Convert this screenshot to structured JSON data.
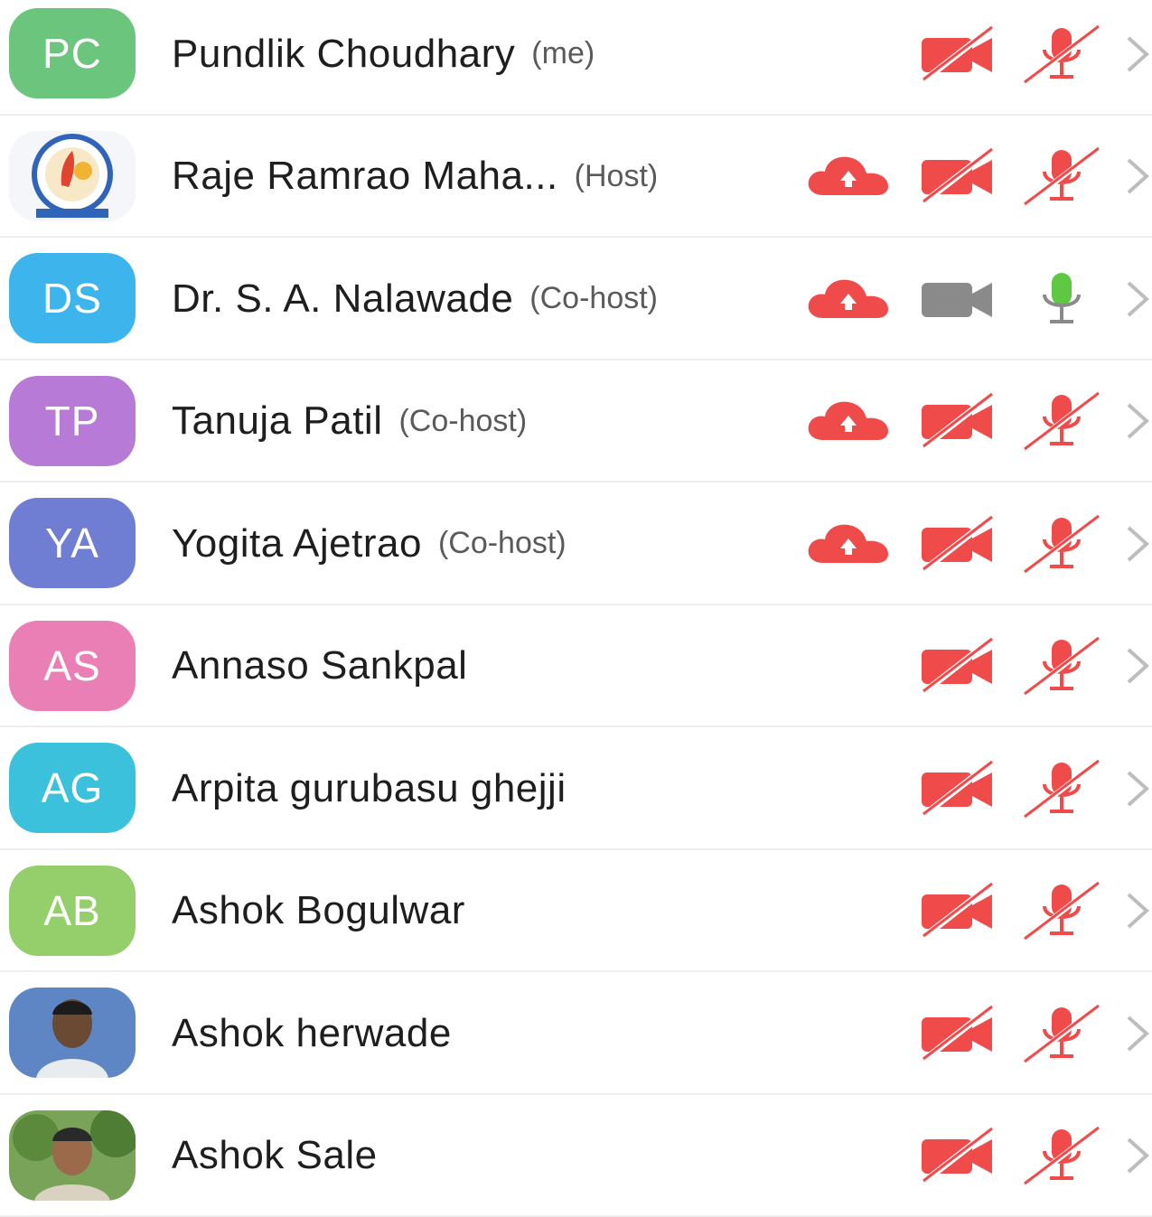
{
  "participants": [
    {
      "initials": "PC",
      "name": "Pundlik Choudhary",
      "role": "(me)",
      "avatar_color": "#6cc57c",
      "photo": false,
      "recording": false,
      "video": "off",
      "mic": "muted"
    },
    {
      "initials": "",
      "name": "Raje Ramrao Maha...",
      "role": "(Host)",
      "avatar_color": "#ffffff",
      "photo": "logo",
      "recording": true,
      "video": "off",
      "mic": "muted"
    },
    {
      "initials": "DS",
      "name": "Dr. S. A. Nalawade",
      "role": "(Co-host)",
      "avatar_color": "#3db5ec",
      "photo": false,
      "recording": true,
      "video": "inactive",
      "mic": "active"
    },
    {
      "initials": "TP",
      "name": "Tanuja Patil",
      "role": "(Co-host)",
      "avatar_color": "#b77ad6",
      "photo": false,
      "recording": true,
      "video": "off",
      "mic": "muted"
    },
    {
      "initials": "YA",
      "name": "Yogita Ajetrao",
      "role": "(Co-host)",
      "avatar_color": "#6f7ed2",
      "photo": false,
      "recording": true,
      "video": "off",
      "mic": "muted"
    },
    {
      "initials": "AS",
      "name": "Annaso Sankpal",
      "role": "",
      "avatar_color": "#ea7fb5",
      "photo": false,
      "recording": false,
      "video": "off",
      "mic": "muted"
    },
    {
      "initials": "AG",
      "name": "Arpita gurubasu ghejji",
      "role": "",
      "avatar_color": "#3cc1dd",
      "photo": false,
      "recording": false,
      "video": "off",
      "mic": "muted"
    },
    {
      "initials": "AB",
      "name": "Ashok Bogulwar",
      "role": "",
      "avatar_color": "#95cf6b",
      "photo": false,
      "recording": false,
      "video": "off",
      "mic": "muted"
    },
    {
      "initials": "",
      "name": "Ashok herwade",
      "role": "",
      "avatar_color": "#5f86c4",
      "photo": "portrait",
      "recording": false,
      "video": "off",
      "mic": "muted"
    },
    {
      "initials": "",
      "name": "Ashok Sale",
      "role": "",
      "avatar_color": "#7aa35a",
      "photo": "outdoor",
      "recording": false,
      "video": "off",
      "mic": "muted"
    }
  ],
  "colors": {
    "alert_red": "#f04b4b",
    "inactive_gray": "#8a8a8a",
    "active_green": "#5fc843",
    "chevron": "#bdbdbd"
  },
  "icons": {
    "recording": "cloud-record-icon",
    "video_off": "video-off-icon",
    "video": "video-icon",
    "mic_muted": "mic-muted-icon",
    "mic_active": "mic-active-icon",
    "chevron": "chevron-right-icon"
  }
}
